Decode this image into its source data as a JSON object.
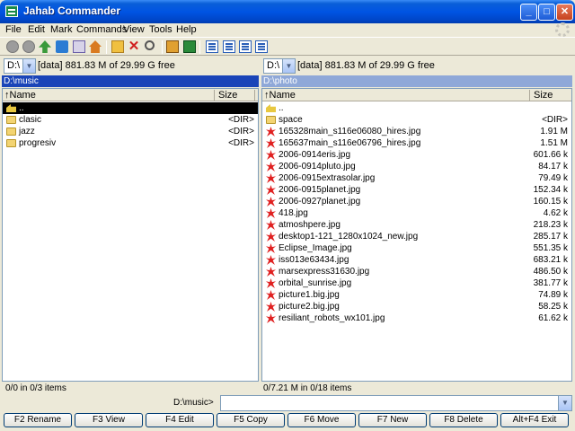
{
  "window": {
    "title": "Jahab Commander"
  },
  "menu": [
    "File",
    "Edit",
    "Mark",
    "Commands",
    "View",
    "Tools",
    "Help"
  ],
  "left": {
    "drive": "D:\\",
    "drive_info": "[data]  881.83 M of 29.99 G free",
    "path": "D:\\music",
    "col_name": "↑Name",
    "col_size": "Size",
    "rows": [
      {
        "name": "..",
        "size": "",
        "type": "up"
      },
      {
        "name": "clasic",
        "size": "<DIR>",
        "type": "folder"
      },
      {
        "name": "jazz",
        "size": "<DIR>",
        "type": "folder"
      },
      {
        "name": "progresiv",
        "size": "<DIR>",
        "type": "folder"
      }
    ],
    "status": "0/0 in 0/3 items"
  },
  "right": {
    "drive": "D:\\",
    "drive_info": "[data]  881.83 M of 29.99 G free",
    "path": "D:\\photo",
    "col_name": "↑Name",
    "col_size": "Size",
    "rows": [
      {
        "name": "..",
        "size": "",
        "type": "up"
      },
      {
        "name": "space",
        "size": "<DIR>",
        "type": "folder"
      },
      {
        "name": "165328main_s116e06080_hires.jpg",
        "size": "1.91 M",
        "type": "file"
      },
      {
        "name": "165637main_s116e06796_hires.jpg",
        "size": "1.51 M",
        "type": "file"
      },
      {
        "name": "2006-0914eris.jpg",
        "size": "601.66 k",
        "type": "file"
      },
      {
        "name": "2006-0914pluto.jpg",
        "size": "84.17 k",
        "type": "file"
      },
      {
        "name": "2006-0915extrasolar.jpg",
        "size": "79.49 k",
        "type": "file"
      },
      {
        "name": "2006-0915planet.jpg",
        "size": "152.34 k",
        "type": "file"
      },
      {
        "name": "2006-0927planet.jpg",
        "size": "160.15 k",
        "type": "file"
      },
      {
        "name": "418.jpg",
        "size": "4.62 k",
        "type": "file"
      },
      {
        "name": "atmoshpere.jpg",
        "size": "218.23 k",
        "type": "file"
      },
      {
        "name": "desktop1-121_1280x1024_new.jpg",
        "size": "285.17 k",
        "type": "file"
      },
      {
        "name": "Eclipse_Image.jpg",
        "size": "551.35 k",
        "type": "file"
      },
      {
        "name": "iss013e63434.jpg",
        "size": "683.21 k",
        "type": "file"
      },
      {
        "name": "marsexpress31630.jpg",
        "size": "486.50 k",
        "type": "file"
      },
      {
        "name": "orbital_sunrise.jpg",
        "size": "381.77 k",
        "type": "file"
      },
      {
        "name": "picture1.big.jpg",
        "size": "74.89 k",
        "type": "file"
      },
      {
        "name": "picture2.big.jpg",
        "size": "58.25 k",
        "type": "file"
      },
      {
        "name": "resiliant_robots_wx101.jpg",
        "size": "61.62 k",
        "type": "file"
      }
    ],
    "status": "0/7.21 M in 0/18 items"
  },
  "command_line": {
    "label": "D:\\music>",
    "value": ""
  },
  "fkeys": [
    "F2 Rename",
    "F3 View",
    "F4 Edit",
    "F5 Copy",
    "F6 Move",
    "F7 New",
    "F8 Delete",
    "Alt+F4 Exit"
  ],
  "toolbar_icons": [
    "back-icon",
    "forward-icon",
    "up-folder-icon",
    "refresh-icon",
    "properties-icon",
    "home-icon",
    "new-folder-icon",
    "delete-icon",
    "find-icon",
    "pack-icon",
    "unpack-icon",
    "view-icon",
    "view-icon",
    "view-icon",
    "view-icon"
  ]
}
